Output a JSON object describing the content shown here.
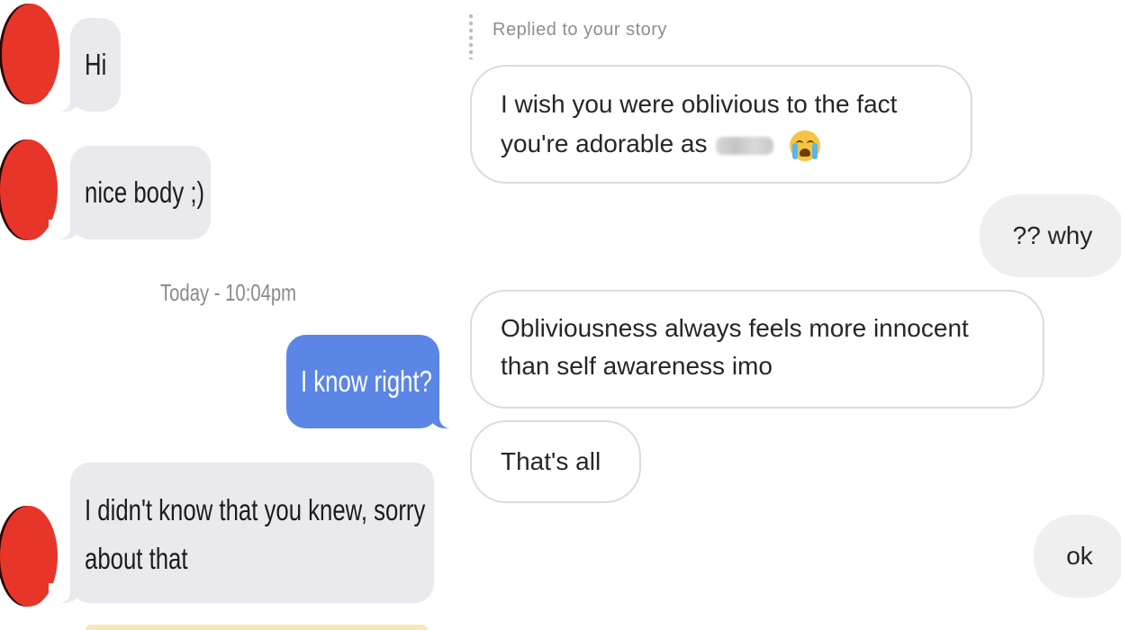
{
  "sms_thread": {
    "messages_incoming_1": "Hi",
    "messages_incoming_2": "nice body ;)",
    "timestamp": "Today - 10:04pm",
    "messages_outgoing_1": "I know right?",
    "messages_incoming_3_line1": "I didn't know that you knew, sorry",
    "messages_incoming_3_line2": "about that",
    "colors": {
      "incoming_bubble": "#e9e9ee",
      "outgoing_bubble": "#5b86e5",
      "avatar": "#e8352a"
    }
  },
  "instagram_thread": {
    "reply_label": "Replied to your story",
    "message_1_line1": "I wish you were oblivious to the fact",
    "message_1_line2_prefix": "you're adorable as",
    "message_1_emoji": "loudly-crying-face-icon",
    "reply_1": "?? why",
    "message_2_line1": "Obliviousness always feels more innocent",
    "message_2_line2": "than self awareness imo",
    "message_3": "That's all",
    "reply_2": "ok",
    "colors": {
      "incoming_border": "#dbdbdb",
      "outgoing_bubble": "#efefef"
    }
  }
}
